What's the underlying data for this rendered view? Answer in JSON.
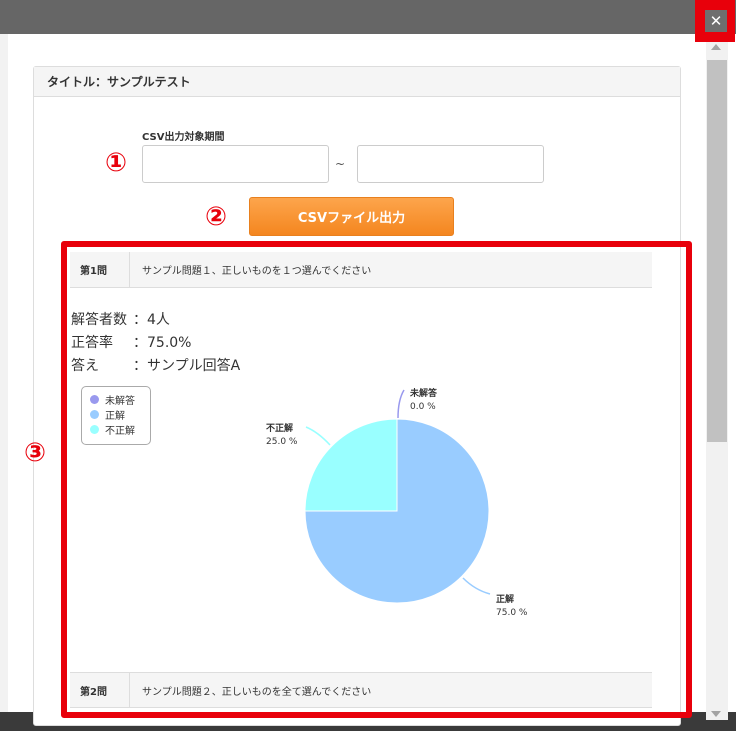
{
  "window": {
    "close_glyph": "✕"
  },
  "panel": {
    "title": "タイトル：サンプルテスト"
  },
  "csv": {
    "period_label": "CSV出力対象期間",
    "start_value": "",
    "end_value": "",
    "separator": "~",
    "export_button": "CSVファイル出力"
  },
  "annotations": {
    "one": "①",
    "two": "②",
    "three": "③",
    "color": "#e8000b"
  },
  "questions": [
    {
      "number": "第1問",
      "text": "サンプル問題１、正しいものを１つ選んでください",
      "respondents_label": "解答者数",
      "respondents_value": "：4人",
      "rate_label": "正答率",
      "rate_value": "：75.0%",
      "answer_label": "答え",
      "answer_value": "：サンプル回答A"
    },
    {
      "number": "第2問",
      "text": "サンプル問題２、正しいものを全て選んでください"
    }
  ],
  "chart_data": {
    "type": "pie",
    "legend_position": "top-left",
    "slices": [
      {
        "name": "未解答",
        "value": 0.0,
        "label": "0.0 %",
        "color": "#9999ee"
      },
      {
        "name": "正解",
        "value": 75.0,
        "label": "75.0 %",
        "color": "#99ccff"
      },
      {
        "name": "不正解",
        "value": 25.0,
        "label": "25.0 %",
        "color": "#99ffff"
      }
    ]
  }
}
